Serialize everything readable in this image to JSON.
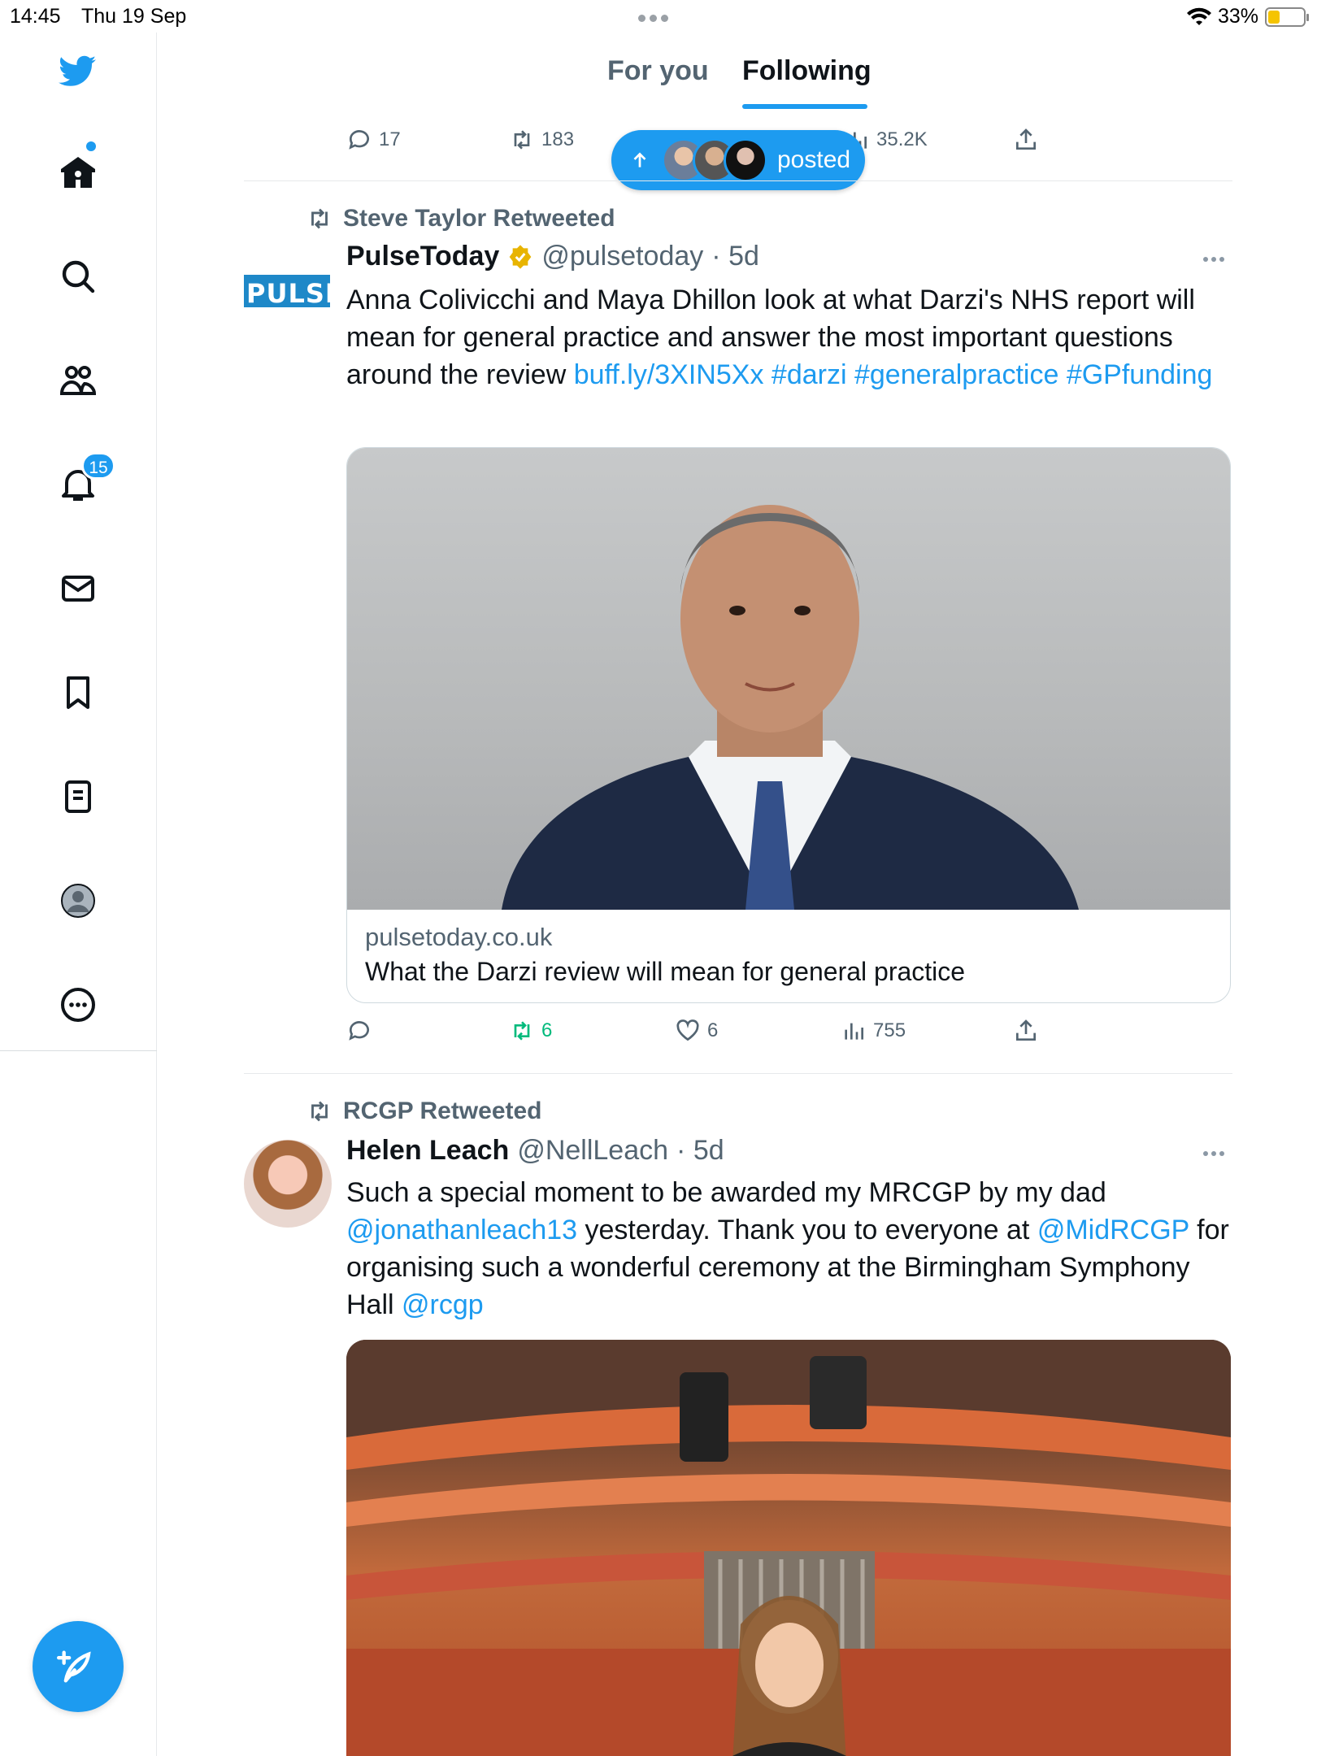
{
  "status_bar": {
    "time": "14:45",
    "date": "Thu 19 Sep",
    "battery": "33%"
  },
  "tabs": {
    "for_you": "For you",
    "following": "Following"
  },
  "sidebar": {
    "notifications_badge": "15"
  },
  "previous_tweet_actions": {
    "replies": "17",
    "retweets": "183",
    "views": "35.2K"
  },
  "posted_pill": {
    "label": "posted"
  },
  "tweets": [
    {
      "retweeted_by": "Steve Taylor Retweeted",
      "avatar_text": "PULSE",
      "name": "PulseToday",
      "handle": "@pulsetoday",
      "time": "· 5d",
      "text_plain": "Anna Colivicchi and Maya Dhillon look at what Darzi's NHS report will mean for general practice and answer the most important questions around the review ",
      "link_url": "buff.ly/3XIN5Xx",
      "tags": [
        "#darzi",
        "#generalpractice",
        "#GPfunding"
      ],
      "card": {
        "domain": "pulsetoday.co.uk",
        "title": "What the Darzi review will mean for general practice"
      },
      "stats": {
        "retweets": "6",
        "likes": "6",
        "views": "755"
      }
    },
    {
      "retweeted_by": "RCGP Retweeted",
      "name": "Helen Leach",
      "handle": "@NellLeach",
      "time": "· 5d",
      "text_1": "Such a special moment to be awarded my MRCGP by my dad ",
      "mention_1": "@jonathanleach13",
      "text_2": " yesterday. Thank you to everyone at ",
      "mention_2": "@MidRCGP",
      "text_3": " for organising such a wonderful ceremony at the Birmingham Symphony Hall ",
      "mention_3": "@rcgp"
    }
  ],
  "colors": {
    "accent": "#1d9bf0",
    "retweet_green": "#00ba7c",
    "muted": "#536471"
  }
}
